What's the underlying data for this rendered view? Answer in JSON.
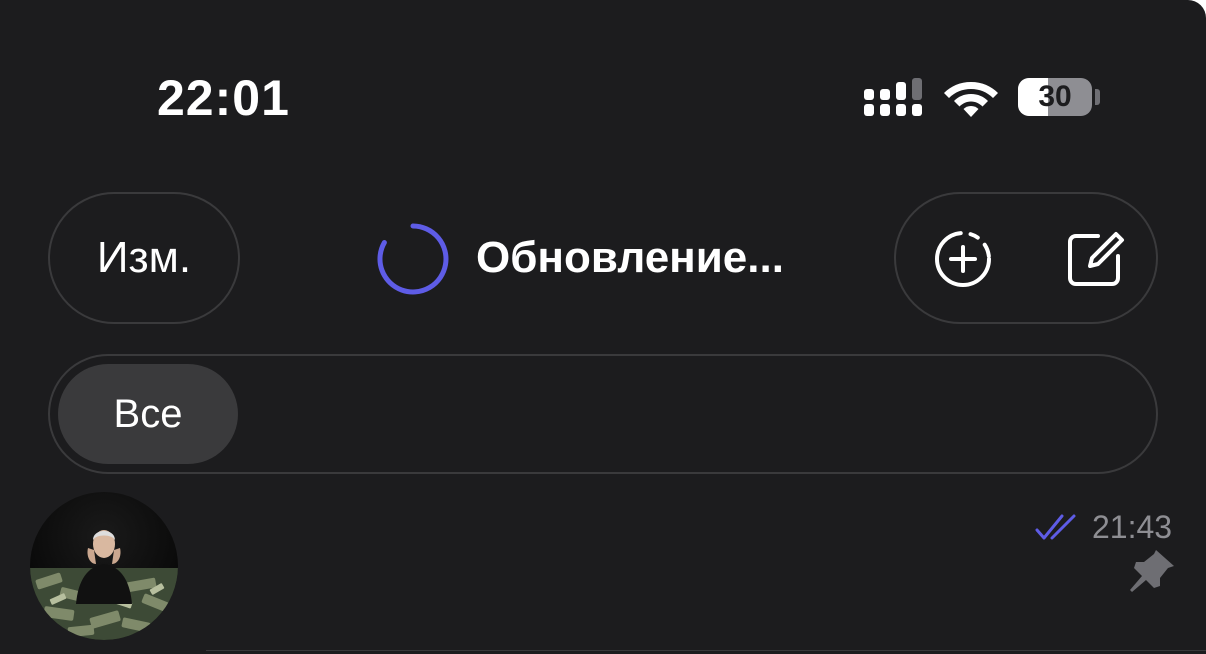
{
  "status_bar": {
    "time": "22:01",
    "battery_text": "30",
    "battery_level": 0.3,
    "icons": [
      "cellular-signal-icon",
      "wifi-icon",
      "battery-icon"
    ]
  },
  "header": {
    "edit_label": "Изм.",
    "title": "Обновление...",
    "spinner_color": "#5e5ce6",
    "actions": [
      "new-story-icon",
      "compose-icon"
    ]
  },
  "filters": {
    "tabs": [
      {
        "label": "Все",
        "selected": true
      }
    ]
  },
  "chats": [
    {
      "time": "21:43",
      "read": true,
      "pinned": true,
      "icons": [
        "avatar",
        "double-check-icon",
        "pin-icon"
      ]
    }
  ],
  "colors": {
    "background": "#1c1c1e",
    "accent": "#5e5ce6",
    "muted": "#8e8e93",
    "border": "#3a3a3c"
  }
}
